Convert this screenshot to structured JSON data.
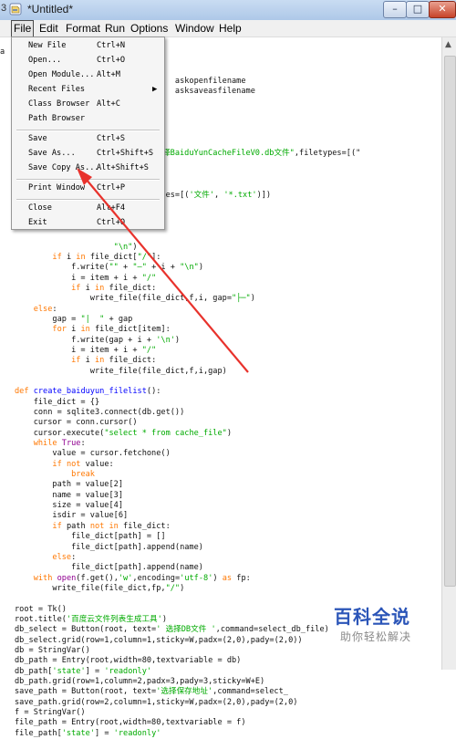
{
  "window": {
    "title": "*Untitled*",
    "left_edge_char": "3",
    "min_label": "–",
    "max_label": "□",
    "close_label": "✕"
  },
  "menubar": [
    "File",
    "Edit",
    "Format",
    "Run",
    "Options",
    "Window",
    "Help"
  ],
  "file_menu": [
    {
      "label": "New File",
      "accel": "Ctrl+N"
    },
    {
      "label": "Open...",
      "accel": "Ctrl+O"
    },
    {
      "label": "Open Module...",
      "accel": "Alt+M"
    },
    {
      "label": "Recent Files",
      "accel": "",
      "submenu": "▶"
    },
    {
      "label": "Class Browser",
      "accel": "Alt+C"
    },
    {
      "label": "Path Browser",
      "accel": ""
    },
    {
      "label": "Save",
      "accel": "Ctrl+S"
    },
    {
      "label": "Save As...",
      "accel": "Ctrl+Shift+S"
    },
    {
      "label": "Save Copy As...",
      "accel": "Alt+Shift+S"
    },
    {
      "label": "Print Window",
      "accel": "Ctrl+P"
    },
    {
      "label": "Close",
      "accel": "Alt+F4"
    },
    {
      "label": "Exit",
      "accel": "Ctrl+Q"
    }
  ],
  "code_lines": [
    [
      {
        "t": ""
      }
    ],
    [
      {
        "t": ""
      }
    ],
    [
      {
        "t": ""
      }
    ],
    [
      {
        "t": "                                  askopenfilename"
      }
    ],
    [
      {
        "t": "                                  asksaveasfilename"
      }
    ],
    [
      {
        "t": ""
      }
    ],
    [
      {
        "t": ""
      }
    ],
    [
      {
        "t": ""
      }
    ],
    [
      {
        "t": ""
      }
    ],
    [
      {
        "t": ""
      }
    ],
    [
      {
        "t": "                    (title="
      },
      {
        "t": "\"请选择BaiduYunCacheFileV0.db文件\"",
        "c": "s"
      },
      {
        "t": ",filetypes=[(\""
      }
    ],
    [
      {
        "t": ""
      }
    ],
    [
      {
        "t": ""
      }
    ],
    [
      {
        "t": ""
      }
    ],
    [
      {
        "t": "                    name(filetypes=[("
      },
      {
        "t": "'文件'",
        "c": "s"
      },
      {
        "t": ", "
      },
      {
        "t": "'*.txt'",
        "c": "s"
      },
      {
        "t": ")])"
      }
    ],
    [
      {
        "t": ""
      }
    ],
    [
      {
        "t": ""
      }
    ],
    [
      {
        "t": "                    em, gap="
      },
      {
        "t": "\"\"",
        "c": "s"
      },
      {
        "t": "):"
      }
    ],
    [
      {
        "t": ""
      }
    ],
    [
      {
        "t": "                     "
      },
      {
        "t": "\"\\n\"",
        "c": "s"
      },
      {
        "t": ")"
      }
    ],
    [
      {
        "t": "        "
      },
      {
        "t": "if",
        "c": "k"
      },
      {
        "t": " i "
      },
      {
        "t": "in",
        "c": "k"
      },
      {
        "t": " file_dict["
      },
      {
        "t": "\"/\"",
        "c": "s"
      },
      {
        "t": "]:"
      }
    ],
    [
      {
        "t": "            f.write("
      },
      {
        "t": "\"\"",
        "c": "s"
      },
      {
        "t": " + "
      },
      {
        "t": "\"—\"",
        "c": "s"
      },
      {
        "t": " + i + "
      },
      {
        "t": "\"\\n\"",
        "c": "s"
      },
      {
        "t": ")"
      }
    ],
    [
      {
        "t": "            i = item + i + "
      },
      {
        "t": "\"/\"",
        "c": "s"
      }
    ],
    [
      {
        "t": "            "
      },
      {
        "t": "if",
        "c": "k"
      },
      {
        "t": " i "
      },
      {
        "t": "in",
        "c": "k"
      },
      {
        "t": " file_dict:"
      }
    ],
    [
      {
        "t": "                write_file(file_dict,f,i, gap="
      },
      {
        "t": "\"├─\"",
        "c": "s"
      },
      {
        "t": ")"
      }
    ],
    [
      {
        "t": "    "
      },
      {
        "t": "else",
        "c": "k"
      },
      {
        "t": ":"
      }
    ],
    [
      {
        "t": "        gap = "
      },
      {
        "t": "\"|  \"",
        "c": "s"
      },
      {
        "t": " + gap"
      }
    ],
    [
      {
        "t": "        "
      },
      {
        "t": "for",
        "c": "k"
      },
      {
        "t": " i "
      },
      {
        "t": "in",
        "c": "k"
      },
      {
        "t": " file_dict[item]:"
      }
    ],
    [
      {
        "t": "            f.write(gap + i + "
      },
      {
        "t": "'\\n'",
        "c": "s"
      },
      {
        "t": ")"
      }
    ],
    [
      {
        "t": "            i = item + i + "
      },
      {
        "t": "\"/\"",
        "c": "s"
      }
    ],
    [
      {
        "t": "            "
      },
      {
        "t": "if",
        "c": "k"
      },
      {
        "t": " i "
      },
      {
        "t": "in",
        "c": "k"
      },
      {
        "t": " file_dict:"
      }
    ],
    [
      {
        "t": "                write_file(file_dict,f,i,gap)"
      }
    ],
    [
      {
        "t": ""
      }
    ],
    [
      {
        "t": "def ",
        "c": "k"
      },
      {
        "t": "create_baiduyun_filelist",
        "c": "f"
      },
      {
        "t": "():"
      }
    ],
    [
      {
        "t": "    file_dict = {}"
      }
    ],
    [
      {
        "t": "    conn = sqlite3.connect(db.get())"
      }
    ],
    [
      {
        "t": "    cursor = conn.cursor()"
      }
    ],
    [
      {
        "t": "    cursor.execute("
      },
      {
        "t": "\"select * from cache_file\"",
        "c": "s"
      },
      {
        "t": ")"
      }
    ],
    [
      {
        "t": "    "
      },
      {
        "t": "while",
        "c": "k"
      },
      {
        "t": " "
      },
      {
        "t": "True",
        "c": "b"
      },
      {
        "t": ":"
      }
    ],
    [
      {
        "t": "        value = cursor.fetchone()"
      }
    ],
    [
      {
        "t": "        "
      },
      {
        "t": "if",
        "c": "k"
      },
      {
        "t": " "
      },
      {
        "t": "not",
        "c": "k"
      },
      {
        "t": " value:"
      }
    ],
    [
      {
        "t": "            "
      },
      {
        "t": "break",
        "c": "k"
      }
    ],
    [
      {
        "t": "        path = value[2]"
      }
    ],
    [
      {
        "t": "        name = value[3]"
      }
    ],
    [
      {
        "t": "        size = value[4]"
      }
    ],
    [
      {
        "t": "        isdir = value[6]"
      }
    ],
    [
      {
        "t": "        "
      },
      {
        "t": "if",
        "c": "k"
      },
      {
        "t": " path "
      },
      {
        "t": "not in",
        "c": "k"
      },
      {
        "t": " file_dict:"
      }
    ],
    [
      {
        "t": "            file_dict[path] = []"
      }
    ],
    [
      {
        "t": "            file_dict[path].append(name)"
      }
    ],
    [
      {
        "t": "        "
      },
      {
        "t": "else",
        "c": "k"
      },
      {
        "t": ":"
      }
    ],
    [
      {
        "t": "            file_dict[path].append(name)"
      }
    ],
    [
      {
        "t": "    "
      },
      {
        "t": "with",
        "c": "k"
      },
      {
        "t": " "
      },
      {
        "t": "open",
        "c": "b"
      },
      {
        "t": "(f.get(),"
      },
      {
        "t": "'w'",
        "c": "s"
      },
      {
        "t": ",encoding="
      },
      {
        "t": "'utf-8'",
        "c": "s"
      },
      {
        "t": ") "
      },
      {
        "t": "as",
        "c": "k"
      },
      {
        "t": " fp:"
      }
    ],
    [
      {
        "t": "        write_file(file_dict,fp,"
      },
      {
        "t": "\"/\"",
        "c": "s"
      },
      {
        "t": ")"
      }
    ],
    [
      {
        "t": ""
      }
    ],
    [
      {
        "t": "root = Tk()"
      }
    ],
    [
      {
        "t": "root.title("
      },
      {
        "t": "'百度云文件列表生成工具'",
        "c": "s"
      },
      {
        "t": ")"
      }
    ],
    [
      {
        "t": "db_select = Button(root, text="
      },
      {
        "t": "' 选择DB文件 '",
        "c": "s"
      },
      {
        "t": ",command=select_db_file)"
      }
    ],
    [
      {
        "t": "db_select.grid(row=1,column=1,sticky=W,padx=(2,0),pady=(2,0))"
      }
    ],
    [
      {
        "t": "db = StringVar()"
      }
    ],
    [
      {
        "t": "db_path = Entry(root,width=80,textvariable = db)"
      }
    ],
    [
      {
        "t": "db_path["
      },
      {
        "t": "'state'",
        "c": "s"
      },
      {
        "t": "] = "
      },
      {
        "t": "'readonly'",
        "c": "s"
      }
    ],
    [
      {
        "t": "db_path.grid(row=1,column=2,padx=3,pady=3,sticky=W+E)"
      }
    ],
    [
      {
        "t": "save_path = Button(root, text="
      },
      {
        "t": "'选择保存地址'",
        "c": "s"
      },
      {
        "t": ",command=select_"
      }
    ],
    [
      {
        "t": "save_path.grid(row=2,column=1,sticky=W,padx=(2,0),pady=(2,0)"
      }
    ],
    [
      {
        "t": "f = StringVar()"
      }
    ],
    [
      {
        "t": "file_path = Entry(root,width=80,textvariable = f)"
      }
    ],
    [
      {
        "t": "file_path["
      },
      {
        "t": "'state'",
        "c": "s"
      },
      {
        "t": "] = "
      },
      {
        "t": "'readonly'",
        "c": "s"
      }
    ]
  ],
  "gutter_mark": "a",
  "watermark": {
    "title": "百科全说",
    "subtitle": "助你轻松解决"
  },
  "colors": {
    "keyword": "#ff7700",
    "string": "#00aa00",
    "defname": "#0000ff",
    "builtin": "#900090",
    "arrow": "#e8322c"
  }
}
